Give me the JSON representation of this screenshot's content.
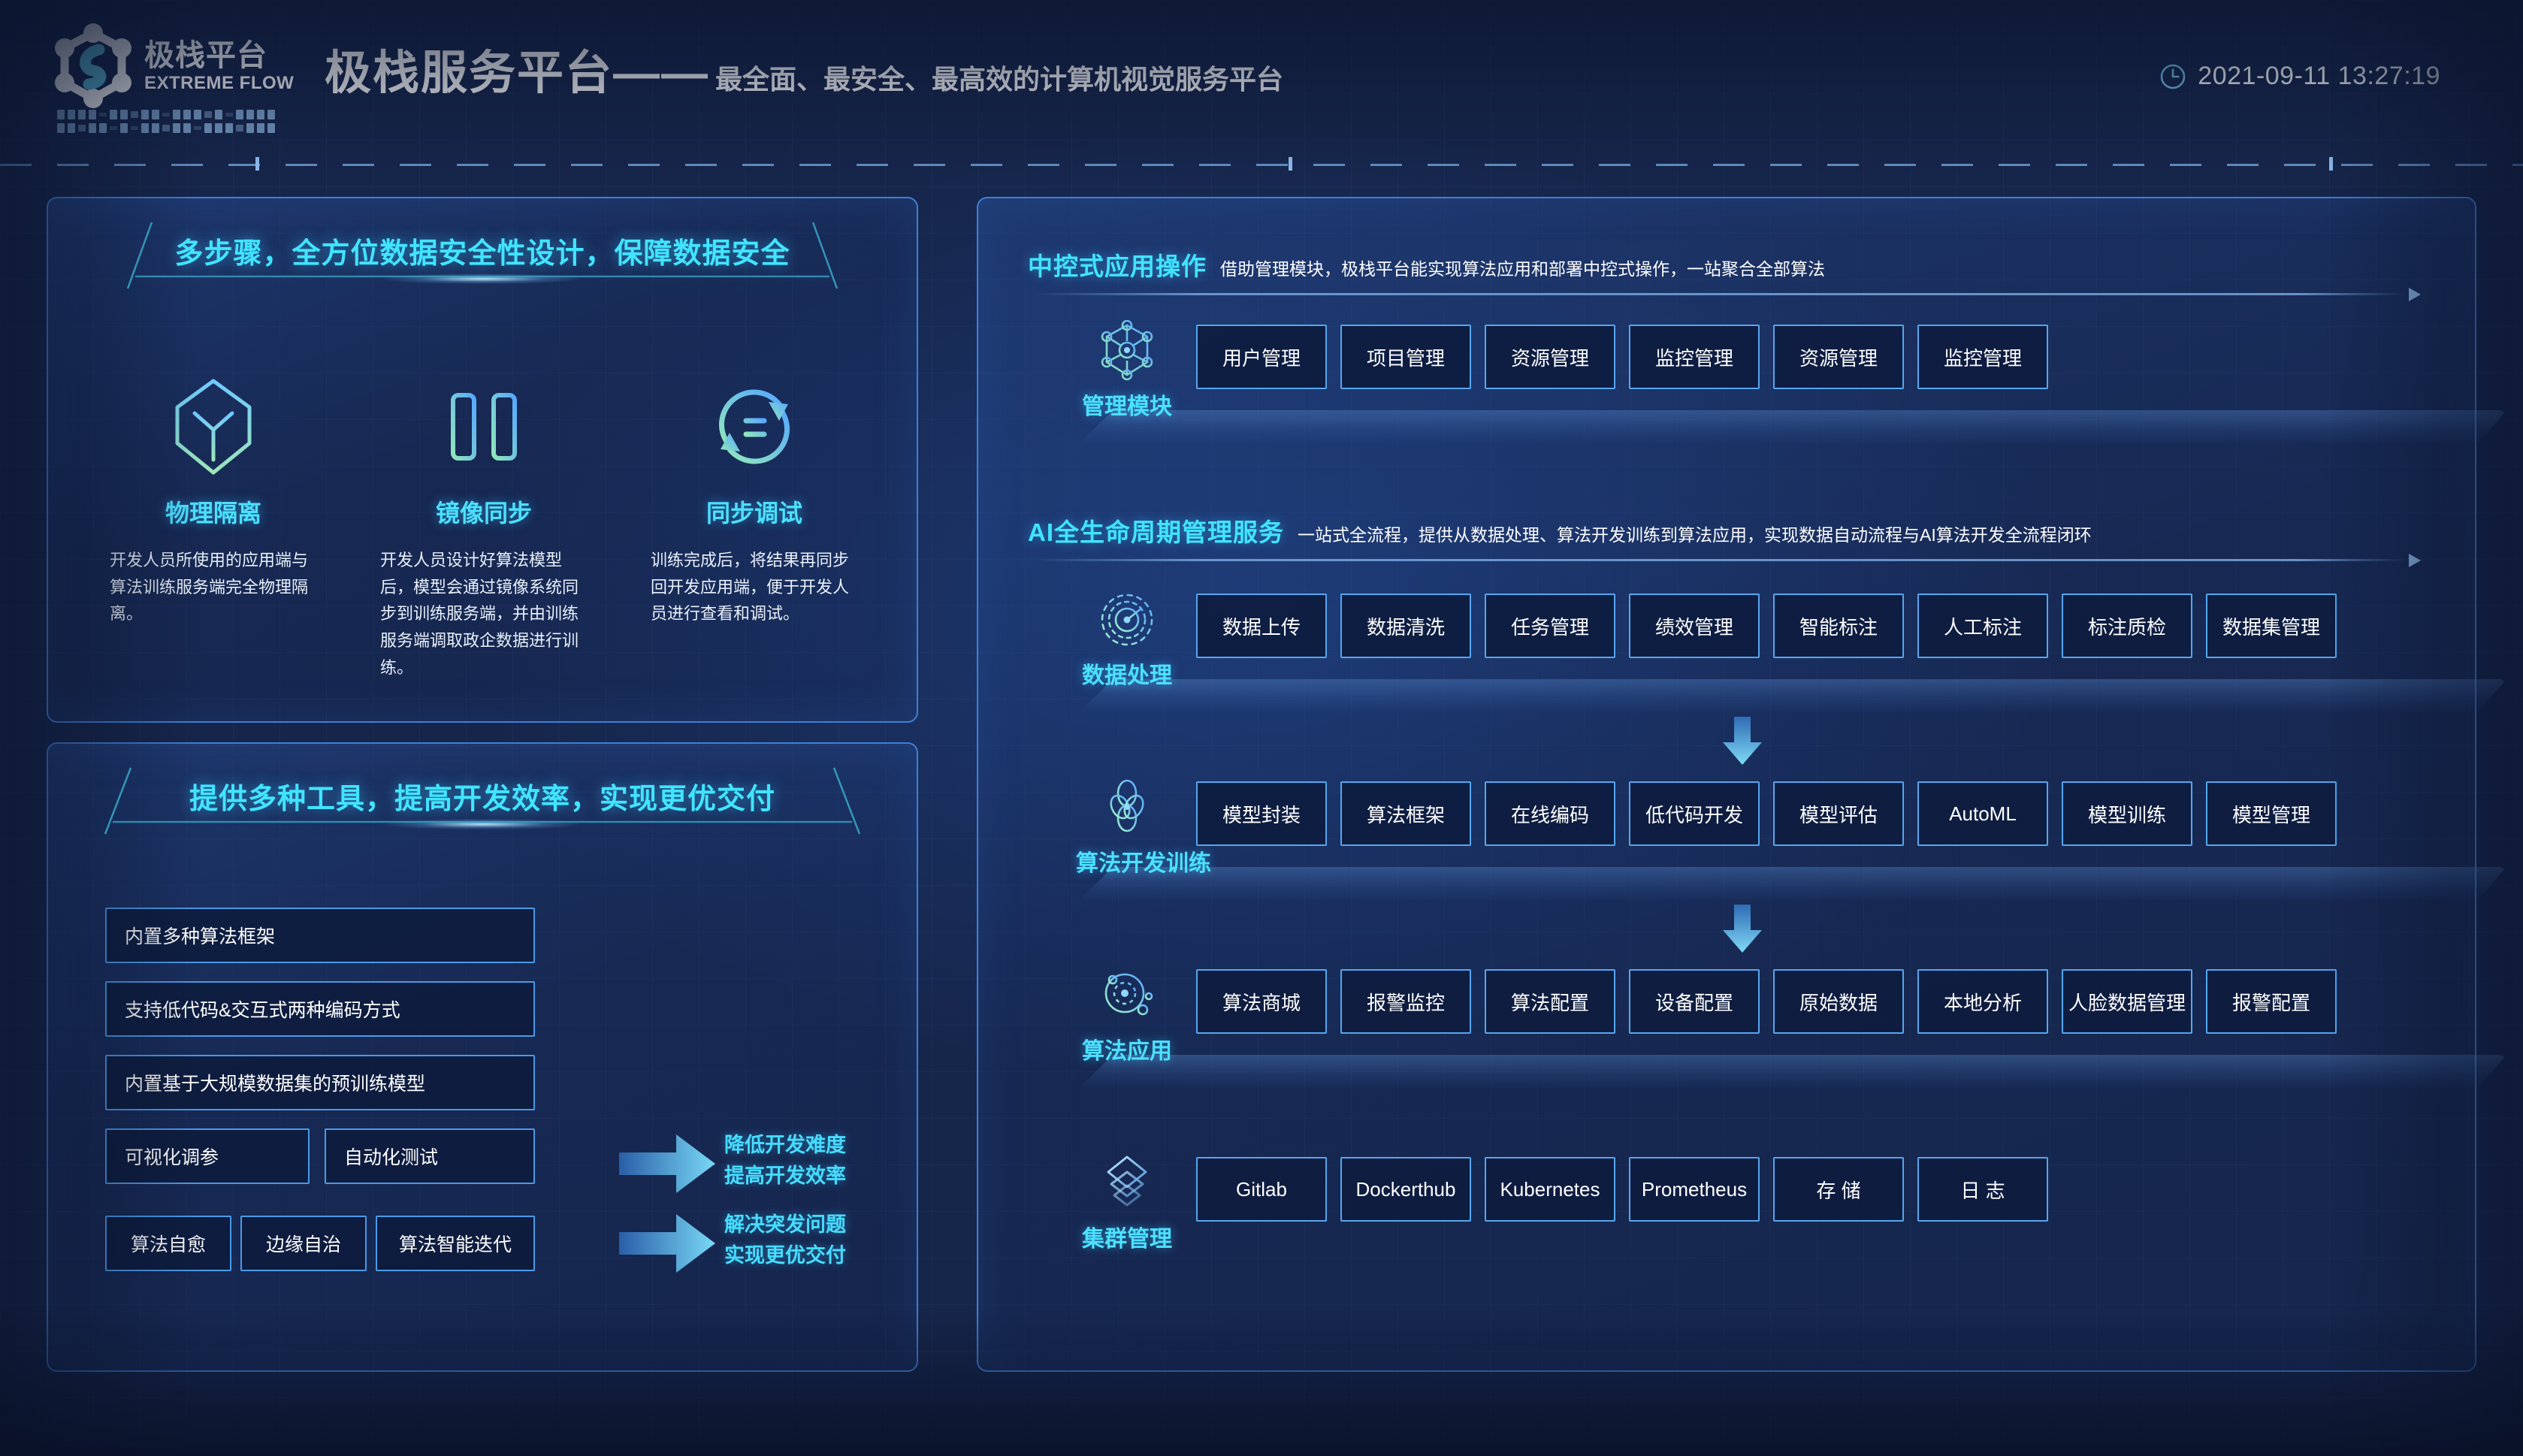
{
  "header": {
    "logo_cn": "极栈平台",
    "logo_en": "EXTREME FLOW",
    "title": "极栈服务平台——",
    "subtitle": "最全面、最安全、最高效的计算机视觉服务平台",
    "clock_icon": "clock-icon",
    "datetime": "2021-09-11 13:27:19"
  },
  "security_panel": {
    "banner": "多步骤，全方位数据安全性设计，保障数据安全",
    "features": [
      {
        "icon": "hexagon-shield-icon",
        "name": "物理隔离",
        "desc": "开发人员所使用的应用端与算法训练服务端完全物理隔离。"
      },
      {
        "icon": "mirror-sync-icon",
        "name": "镜像同步",
        "desc": "开发人员设计好算法模型后，模型会通过镜像系统同步到训练服务端，并由训练服务端调取政企数据进行训练。"
      },
      {
        "icon": "sync-refresh-icon",
        "name": "同步调试",
        "desc": "训练完成后，将结果再同步回开发应用端，便于开发人员进行查看和调试。"
      }
    ]
  },
  "tools_panel": {
    "banner": "提供多种工具，提高开发效率，实现更优交付",
    "boxes": [
      "内置多种算法框架",
      "支持低代码&交互式两种编码方式",
      "内置基于大规模数据集的预训练模型",
      "可视化调参",
      "自动化测试",
      "算法自愈",
      "边缘自治",
      "算法智能迭代"
    ],
    "outcomes": [
      {
        "line1": "降低开发难度",
        "line2": "提高开发效率",
        "arrow": "arrow-right-icon"
      },
      {
        "line1": "解决突发问题",
        "line2": "实现更优交付",
        "arrow": "arrow-right-icon"
      }
    ]
  },
  "main_panel": {
    "sections": [
      {
        "title": "中控式应用操作",
        "subtitle": "借助管理模块，极栈平台能实现算法应用和部署中控式操作，一站聚合全部算法",
        "rows": [
          {
            "icon": "network-nodes-icon",
            "label": "管理模块",
            "chips": [
              "用户管理",
              "项目管理",
              "资源管理",
              "监控管理",
              "资源管理",
              "监控管理"
            ]
          }
        ]
      },
      {
        "title": "AI全生命周期管理服务",
        "subtitle": "一站式全流程，提供从数据处理、算法开发训练到算法应用，实现数据自动流程与AI算法开发全流程闭环",
        "rows": [
          {
            "icon": "radar-target-icon",
            "label": "数据处理",
            "chips": [
              "数据上传",
              "数据清洗",
              "任务管理",
              "绩效管理",
              "智能标注",
              "人工标注",
              "标注质检",
              "数据集管理"
            ]
          },
          {
            "icon": "molecule-chain-icon",
            "label": "算法开发训练",
            "chips": [
              "模型封装",
              "算法框架",
              "在线编码",
              "低代码开发",
              "模型评估",
              "AutoML",
              "模型训练",
              "模型管理"
            ]
          },
          {
            "icon": "orbit-atom-icon",
            "label": "算法应用",
            "chips": [
              "算法商城",
              "报警监控",
              "算法配置",
              "设备配置",
              "原始数据",
              "本地分析",
              "人脸数据管理",
              "报警配置"
            ]
          },
          {
            "icon": "stacked-layers-icon",
            "label": "集群管理",
            "chips": [
              "Gitlab",
              "Dockerthub",
              "Kubernetes",
              "Prometheus",
              "存 储",
              "日 志"
            ]
          }
        ]
      }
    ],
    "flow_arrows": [
      "arrow-down-icon",
      "arrow-down-icon"
    ]
  },
  "colors": {
    "background": "#16254a",
    "panel_border": "#3f7fd6",
    "accent_cyan": "#41e4ff",
    "chip_border": "#55a7ef",
    "text_white": "#ffffff"
  }
}
